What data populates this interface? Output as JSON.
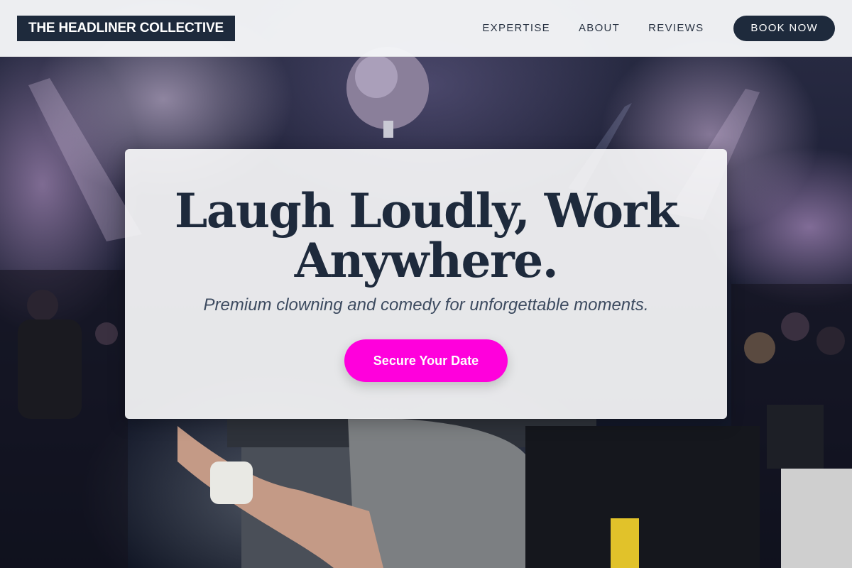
{
  "header": {
    "brand": "THE HEADLINER COLLECTIVE",
    "nav": [
      {
        "label": "EXPERTISE"
      },
      {
        "label": "ABOUT"
      },
      {
        "label": "REVIEWS"
      }
    ],
    "cta_label": "BOOK NOW"
  },
  "hero": {
    "title_line1": "Laugh Loudly, Work",
    "title_line2": "Anywhere.",
    "tagline": "Premium clowning and comedy for unforgettable moments.",
    "cta_label": "Secure Your Date"
  },
  "colors": {
    "brand_navy": "#1e2a3c",
    "accent_magenta": "#ff00dc",
    "header_bg": "#f6f7f9"
  }
}
